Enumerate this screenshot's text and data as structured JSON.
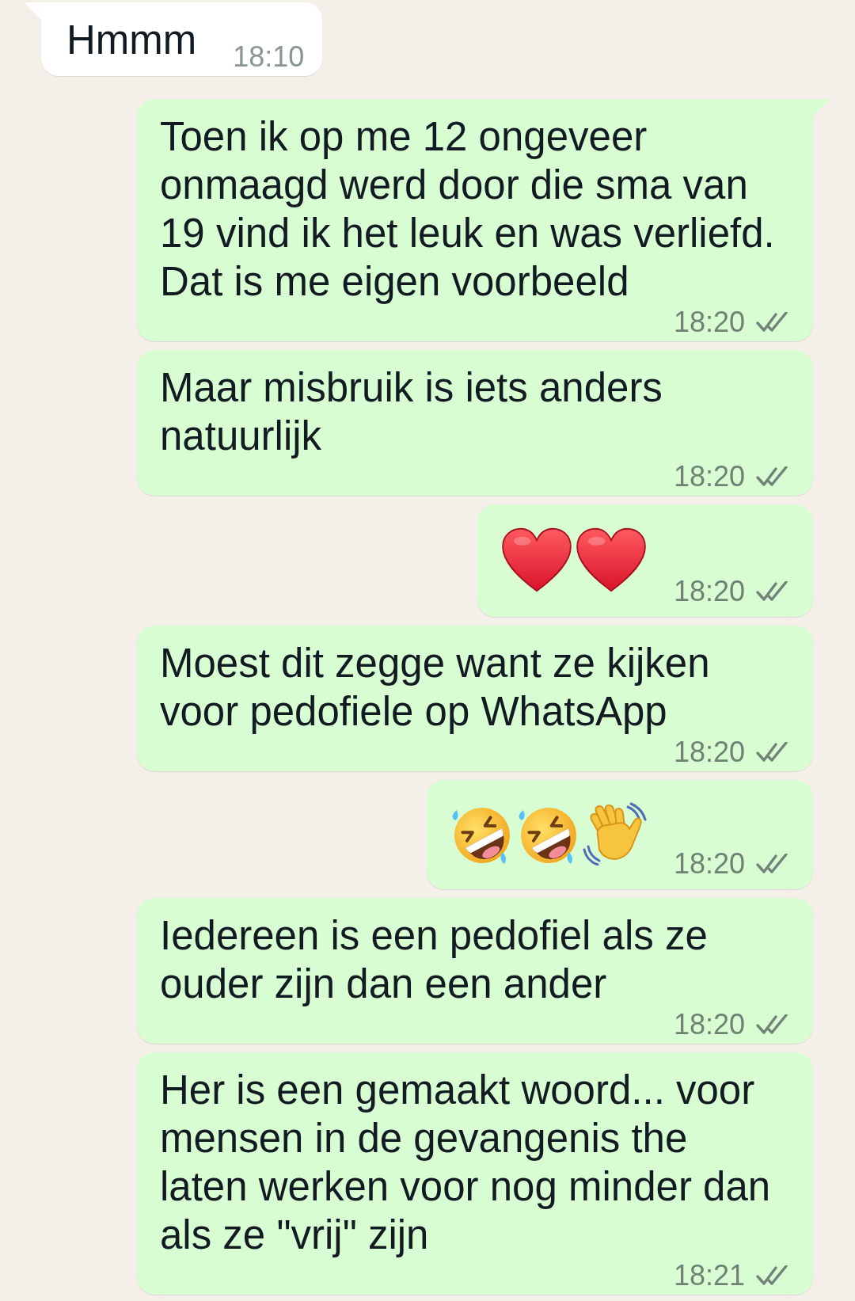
{
  "messages": [
    {
      "outgoing": false,
      "tail": true,
      "kind": "text",
      "text": "Hmmm",
      "time": "18:10"
    },
    {
      "outgoing": true,
      "tail": true,
      "kind": "text",
      "text": "Toen ik op me 12 ongeveer onmaagd werd door die sma van 19 vind ik het leuk en was verliefd. Dat is me eigen voorbeeld",
      "time": "18:20",
      "read": false
    },
    {
      "outgoing": true,
      "tail": false,
      "kind": "text",
      "text": "Maar misbruik is iets anders natuurlijk",
      "time": "18:20",
      "read": false
    },
    {
      "outgoing": true,
      "tail": false,
      "kind": "emoji",
      "emojis": [
        {
          "kind": "heart"
        },
        {
          "kind": "heart"
        }
      ],
      "time": "18:20",
      "read": false
    },
    {
      "outgoing": true,
      "tail": false,
      "kind": "text",
      "text": "Moest dit zegge want ze kijken voor pedofiele op WhatsApp",
      "time": "18:20",
      "read": false
    },
    {
      "outgoing": true,
      "tail": false,
      "kind": "emoji",
      "emojis": [
        {
          "kind": "laughing"
        },
        {
          "kind": "laughing"
        },
        {
          "kind": "wave"
        }
      ],
      "time": "18:20",
      "read": false
    },
    {
      "outgoing": true,
      "tail": false,
      "kind": "text",
      "text": "Iedereen is een pedofiel als ze ouder zijn dan een ander",
      "time": "18:20",
      "read": false
    },
    {
      "outgoing": true,
      "tail": false,
      "kind": "text",
      "text": "Her is een gemaakt woord... voor mensen in de gevangenis the laten werken voor nog minder dan als ze \"vrij\" zijn",
      "time": "18:21",
      "read": false
    }
  ]
}
